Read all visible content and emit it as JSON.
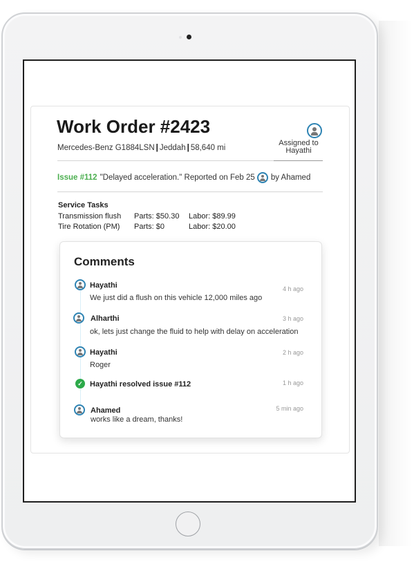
{
  "work_order": {
    "title": "Work Order #2423",
    "vehicle": "Mercedes-Benz G1884LSN",
    "location": "Jeddah",
    "mileage": "58,640 mi",
    "assigned_label": "Assigned to",
    "assigned_to": "Hayathi"
  },
  "issue": {
    "id": "Issue #112",
    "description": "\"Delayed acceleration.\" Reported on Feb 25",
    "reported_by": "by Ahamed"
  },
  "service_tasks": {
    "heading": "Service Tasks",
    "rows": [
      {
        "name": "Transmission flush",
        "parts": "Parts: $50.30",
        "labor": "Labor: $89.99"
      },
      {
        "name": "Tire Rotation (PM)",
        "parts": "Parts: $0",
        "labor": "Labor: $20.00"
      }
    ]
  },
  "comments": {
    "title": "Comments",
    "items": [
      {
        "author": "Hayathi",
        "text": "We just did a flush on this vehicle 12,000 miles ago",
        "time": "4 h ago",
        "icon": "avatar-icon"
      },
      {
        "author": "Alharthi",
        "text": "ok, lets just change the fluid to help with delay on acceleration",
        "time": "3 h ago",
        "icon": "avatar-icon"
      },
      {
        "author": "Hayathi",
        "text": "Roger",
        "time": "2 h ago",
        "icon": "avatar-icon"
      },
      {
        "author": "Hayathi resolved issue #112",
        "text": "",
        "time": "1 h ago",
        "icon": "check-icon"
      },
      {
        "author": "Ahamed",
        "text": "works like a dream, thanks!",
        "time": "5 min ago",
        "icon": "avatar-icon"
      }
    ]
  },
  "colors": {
    "accent_blue": "#2d83b3",
    "issue_green": "#4caf50",
    "resolved_green": "#2daa4a"
  }
}
